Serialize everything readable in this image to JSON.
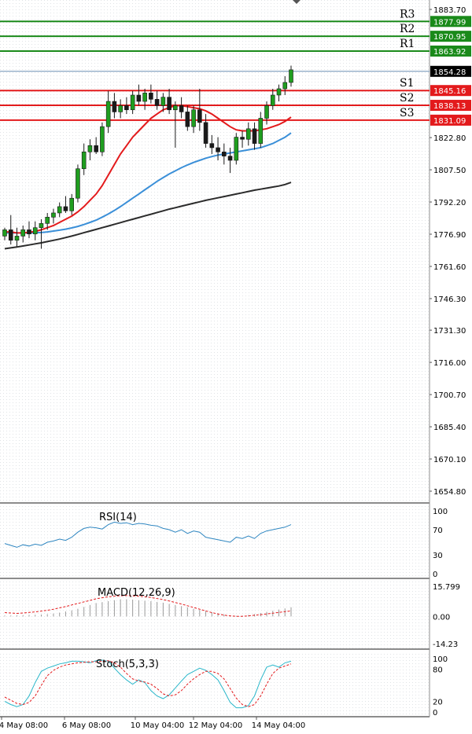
{
  "colors": {
    "background": "#ffffff",
    "grid": "#9aa0a6",
    "resistance": "#1a8a1a",
    "support": "#e31a1c",
    "price_line": "#6b8fb3",
    "bull_candle": "#1f9e1f",
    "bear_candle": "#1a1a1a",
    "sma_fast": "#e31a1c",
    "sma_mid": "#3a8fd8",
    "sma_slow": "#2b2b2b",
    "rsi": "#2e86c1",
    "macd_signal": "#e31a1c",
    "macd_hist": "#9a9a9a",
    "stoch_main": "#2ab7ca",
    "stoch_signal": "#e31a1c",
    "price_box": "#000000"
  },
  "chart_data": {
    "type": "candlestick",
    "price_axis": {
      "ticks": [
        "1883.70",
        "1807.50",
        "1792.20",
        "1776.90",
        "1761.60",
        "1746.30",
        "1731.30",
        "1716.00",
        "1700.70",
        "1685.40",
        "1670.10",
        "1654.80",
        "1822.80"
      ],
      "ylim": [
        1645,
        1889
      ]
    },
    "x_labels": [
      "4 May 08:00",
      "6 May 08:00",
      "10 May 04:00",
      "12 May 04:00",
      "14 May 04:00"
    ],
    "levels": [
      {
        "name": "R3",
        "value": 1877.99,
        "label": "1877.99",
        "kind": "resistance"
      },
      {
        "name": "R2",
        "value": 1870.95,
        "label": "1870.95",
        "kind": "resistance"
      },
      {
        "name": "R1",
        "value": 1863.92,
        "label": "1863.92",
        "kind": "resistance"
      },
      {
        "name": "S1",
        "value": 1845.16,
        "label": "1845.16",
        "kind": "support"
      },
      {
        "name": "S2",
        "value": 1838.13,
        "label": "1838.13",
        "kind": "support"
      },
      {
        "name": "S3",
        "value": 1831.09,
        "label": "1831.09",
        "kind": "support"
      }
    ],
    "current_price": {
      "value": 1854.28,
      "label": "1854.28"
    },
    "candles": [
      [
        1776.0,
        1780.0,
        1774.0,
        1779.0
      ],
      [
        1779.0,
        1786.0,
        1772.0,
        1774.0
      ],
      [
        1774.0,
        1780.0,
        1771.0,
        1776.0
      ],
      [
        1776.0,
        1781.0,
        1773.0,
        1779.0
      ],
      [
        1779.0,
        1783.0,
        1775.0,
        1777.0
      ],
      [
        1777.0,
        1783.0,
        1774.0,
        1780.0
      ],
      [
        1780.0,
        1784.0,
        1770.0,
        1782.0
      ],
      [
        1782.0,
        1787.0,
        1779.0,
        1785.0
      ],
      [
        1785.0,
        1789.0,
        1782.0,
        1787.0
      ],
      [
        1787.0,
        1792.0,
        1785.0,
        1790.0
      ],
      [
        1790.0,
        1795.0,
        1787.0,
        1788.0
      ],
      [
        1788.0,
        1796.0,
        1786.0,
        1794.0
      ],
      [
        1794.0,
        1810.0,
        1792.0,
        1808.0
      ],
      [
        1808.0,
        1820.0,
        1805.0,
        1816.0
      ],
      [
        1816.0,
        1822.0,
        1812.0,
        1819.0
      ],
      [
        1819.0,
        1823.0,
        1815.0,
        1816.0
      ],
      [
        1816.0,
        1830.0,
        1814.0,
        1828.0
      ],
      [
        1828.0,
        1845.0,
        1825.0,
        1840.0
      ],
      [
        1840.0,
        1844.0,
        1832.0,
        1835.0
      ],
      [
        1835.0,
        1841.0,
        1832.0,
        1838.0
      ],
      [
        1838.0,
        1842.0,
        1834.0,
        1836.0
      ],
      [
        1836.0,
        1845.0,
        1834.0,
        1843.0
      ],
      [
        1843.0,
        1848.0,
        1838.0,
        1840.0
      ],
      [
        1840.0,
        1846.0,
        1836.0,
        1844.0
      ],
      [
        1844.0,
        1848.0,
        1839.0,
        1841.0
      ],
      [
        1841.0,
        1845.0,
        1836.0,
        1838.0
      ],
      [
        1838.0,
        1844.0,
        1835.0,
        1842.0
      ],
      [
        1842.0,
        1846.0,
        1834.0,
        1836.0
      ],
      [
        1836.0,
        1840.0,
        1818.0,
        1838.0
      ],
      [
        1838.0,
        1842.0,
        1832.0,
        1835.0
      ],
      [
        1835.0,
        1838.0,
        1826.0,
        1828.0
      ],
      [
        1828.0,
        1838.0,
        1825.0,
        1836.0
      ],
      [
        1836.0,
        1846.0,
        1826.0,
        1830.0
      ],
      [
        1830.0,
        1834.0,
        1818.0,
        1820.0
      ],
      [
        1820.0,
        1824.0,
        1815.0,
        1818.0
      ],
      [
        1818.0,
        1823.0,
        1812.0,
        1816.0
      ],
      [
        1816.0,
        1820.0,
        1810.0,
        1814.0
      ],
      [
        1814.0,
        1818.0,
        1806.0,
        1812.0
      ],
      [
        1812.0,
        1825.0,
        1810.0,
        1823.0
      ],
      [
        1823.0,
        1826.0,
        1818.0,
        1822.0
      ],
      [
        1822.0,
        1830.0,
        1819.0,
        1827.0
      ],
      [
        1827.0,
        1830.0,
        1817.0,
        1820.0
      ],
      [
        1820.0,
        1835.0,
        1818.0,
        1832.0
      ],
      [
        1832.0,
        1840.0,
        1829.0,
        1838.0
      ],
      [
        1838.0,
        1846.0,
        1836.0,
        1843.0
      ],
      [
        1843.0,
        1848.0,
        1840.0,
        1846.0
      ],
      [
        1846.0,
        1852.0,
        1843.0,
        1849.0
      ],
      [
        1849.0,
        1857.0,
        1847.0,
        1855.0
      ]
    ],
    "sma_fast": [
      1778,
      1778,
      1777.5,
      1777.5,
      1777.8,
      1778.2,
      1779,
      1780,
      1781,
      1782.5,
      1784,
      1785.5,
      1787.5,
      1790,
      1793,
      1796,
      1800,
      1805,
      1810,
      1815,
      1819,
      1823,
      1826,
      1829,
      1832,
      1834,
      1836,
      1837,
      1838,
      1838,
      1837.5,
      1837,
      1836.5,
      1835.5,
      1834,
      1832,
      1830,
      1828,
      1826.5,
      1826,
      1826,
      1826,
      1826.5,
      1827,
      1828,
      1829,
      1830.5,
      1832.5
    ],
    "sma_mid": [
      1777.5,
      1777.5,
      1777.5,
      1777.5,
      1777.5,
      1777.6,
      1777.7,
      1778,
      1778.4,
      1778.8,
      1779.3,
      1779.9,
      1780.6,
      1781.5,
      1782.5,
      1783.6,
      1785,
      1786.5,
      1788.2,
      1790,
      1792,
      1794,
      1796,
      1798,
      1800,
      1802,
      1803.8,
      1805.5,
      1807,
      1808.5,
      1809.8,
      1811,
      1812,
      1813,
      1813.8,
      1814.5,
      1815,
      1815.5,
      1816,
      1816.5,
      1817,
      1817.5,
      1818,
      1819,
      1820,
      1821.5,
      1823,
      1825
    ],
    "sma_slow": [
      1770,
      1770.4,
      1770.8,
      1771.3,
      1771.8,
      1772.3,
      1772.8,
      1773.4,
      1774,
      1774.6,
      1775.3,
      1776,
      1776.8,
      1777.6,
      1778.4,
      1779.2,
      1780,
      1780.8,
      1781.6,
      1782.4,
      1783.2,
      1784,
      1784.8,
      1785.6,
      1786.4,
      1787.2,
      1788,
      1788.8,
      1789.5,
      1790.2,
      1790.9,
      1791.6,
      1792.3,
      1793,
      1793.6,
      1794.2,
      1794.8,
      1795.4,
      1796,
      1796.6,
      1797.2,
      1797.8,
      1798.3,
      1798.8,
      1799.3,
      1799.8,
      1800.5,
      1801.5
    ],
    "rsi": {
      "title": "RSI(14)",
      "ticks": [
        "100",
        "70",
        "30",
        "0"
      ],
      "ylim": [
        0,
        100
      ],
      "values": [
        48,
        45,
        42,
        46,
        44,
        47,
        45,
        50,
        52,
        55,
        53,
        58,
        66,
        72,
        74,
        73,
        71,
        78,
        82,
        80,
        81,
        78,
        80,
        79,
        77,
        76,
        72,
        70,
        66,
        70,
        64,
        68,
        66,
        58,
        56,
        54,
        52,
        50,
        58,
        56,
        60,
        56,
        64,
        68,
        70,
        72,
        74,
        78
      ]
    },
    "macd": {
      "title": "MACD(12,26,9)",
      "ticks": [
        "15.799",
        "0.00",
        "-14.23"
      ],
      "ylim": [
        -14.23,
        15.799
      ],
      "hist": [
        0.5,
        0.5,
        0.6,
        0.7,
        0.8,
        0.9,
        1.0,
        1.2,
        1.5,
        2,
        2.6,
        3.2,
        4,
        5,
        6,
        7,
        7.5,
        8,
        8.5,
        9,
        9,
        8.8,
        8.5,
        8.2,
        8,
        7.6,
        7.2,
        6.6,
        6,
        5.4,
        4.8,
        4,
        3.4,
        2.8,
        2.2,
        1.6,
        1.0,
        0.6,
        0.3,
        0.4,
        0.8,
        1.2,
        1.8,
        2.4,
        3.0,
        3.6,
        4.2,
        4.8
      ],
      "signal": [
        2,
        1.8,
        1.6,
        1.8,
        2.1,
        2.4,
        2.8,
        3.2,
        3.8,
        4.5,
        5.2,
        6,
        6.8,
        7.6,
        8.4,
        9.2,
        9.8,
        10.3,
        10.6,
        10.8,
        10.9,
        10.8,
        10.6,
        10.3,
        9.9,
        9.4,
        8.8,
        8.1,
        7.3,
        6.5,
        5.6,
        4.7,
        3.8,
        2.9,
        2.0,
        1.3,
        0.7,
        0.3,
        0.1,
        0.1,
        0.3,
        0.6,
        0.9,
        1.3,
        1.7,
        2.1,
        2.5,
        2.9
      ]
    },
    "stoch": {
      "title": "Stoch(5,3,3)",
      "ticks": [
        "100",
        "80",
        "20",
        "0"
      ],
      "ylim": [
        0,
        100
      ],
      "main": [
        20,
        14,
        10,
        14,
        30,
        55,
        76,
        82,
        86,
        90,
        92,
        95,
        95,
        94,
        92,
        96,
        97,
        95,
        82,
        70,
        60,
        52,
        60,
        55,
        40,
        30,
        25,
        32,
        45,
        58,
        70,
        76,
        82,
        78,
        70,
        60,
        40,
        18,
        8,
        8,
        12,
        30,
        60,
        84,
        88,
        84,
        92,
        95
      ],
      "signal": [
        28,
        22,
        16,
        14,
        18,
        30,
        50,
        68,
        78,
        84,
        88,
        90,
        92,
        93,
        94,
        94,
        95,
        96,
        92,
        84,
        72,
        62,
        58,
        56,
        52,
        44,
        34,
        30,
        32,
        40,
        52,
        62,
        70,
        76,
        76,
        72,
        62,
        44,
        26,
        14,
        10,
        14,
        30,
        52,
        72,
        82,
        86,
        90
      ]
    }
  }
}
